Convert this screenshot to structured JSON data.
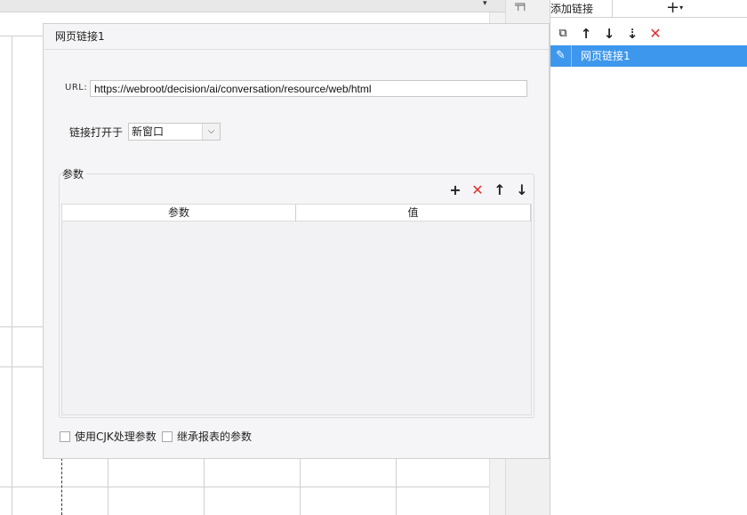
{
  "dialog": {
    "title": "网页链接1",
    "url_label": "URL:",
    "url_value": "https://webroot/decision/ai/conversation/resource/web/html",
    "open_in_label": "链接打开于",
    "open_in_value": "新窗口",
    "params_label": "参数",
    "table_headers": [
      "参数",
      "值"
    ],
    "params_rows": [],
    "checkboxes": [
      {
        "label": "使用CJK处理参数",
        "checked": false
      },
      {
        "label": "继承报表的参数",
        "checked": false
      }
    ]
  },
  "panel": {
    "tab_title": "添加链接",
    "links": [
      {
        "label": "网页链接1",
        "selected": true
      }
    ]
  },
  "colors": {
    "selected_row": "#3d97ed",
    "delete_icon": "#e03030",
    "dialog_bg": "#f5f5f7"
  },
  "icons": {
    "copy": "copy-icon",
    "move_up": "arrow-up-icon",
    "move_down": "arrow-down-icon",
    "sort": "sort-down-icon",
    "delete": "delete-x-icon",
    "add": "plus-icon",
    "edit": "pencil-icon"
  }
}
